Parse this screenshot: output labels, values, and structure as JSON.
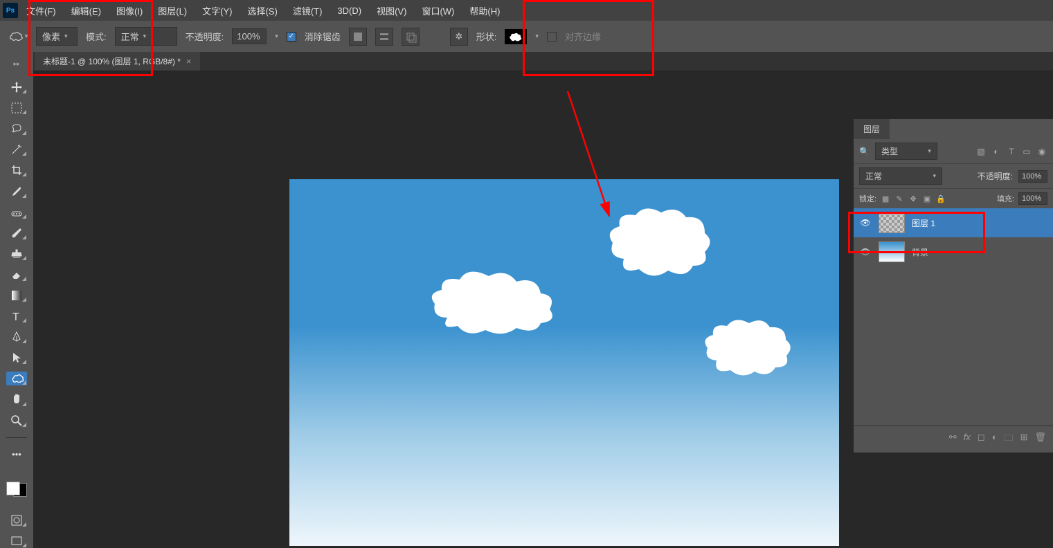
{
  "menu": {
    "items": [
      "文件(F)",
      "编辑(E)",
      "图像(I)",
      "图层(L)",
      "文字(Y)",
      "选择(S)",
      "滤镜(T)",
      "3D(D)",
      "视图(V)",
      "窗口(W)",
      "帮助(H)"
    ]
  },
  "options": {
    "tool_mode": "像素",
    "mode_label": "模式:",
    "blend_mode": "正常",
    "opacity_label": "不透明度:",
    "opacity_value": "100%",
    "antialias_label": "消除锯齿",
    "shape_label": "形状:",
    "align_label": "对齐边缘"
  },
  "tab": {
    "title": "未标题-1 @ 100% (图层 1, RGB/8#) *"
  },
  "layers_panel": {
    "title": "图层",
    "filter_label": "类型",
    "blend": "正常",
    "opacity_label": "不透明度:",
    "opacity_value": "100%",
    "lock_label": "锁定:",
    "fill_label": "填充:",
    "fill_value": "100%",
    "layer1": "图层 1",
    "bg": "背景"
  }
}
